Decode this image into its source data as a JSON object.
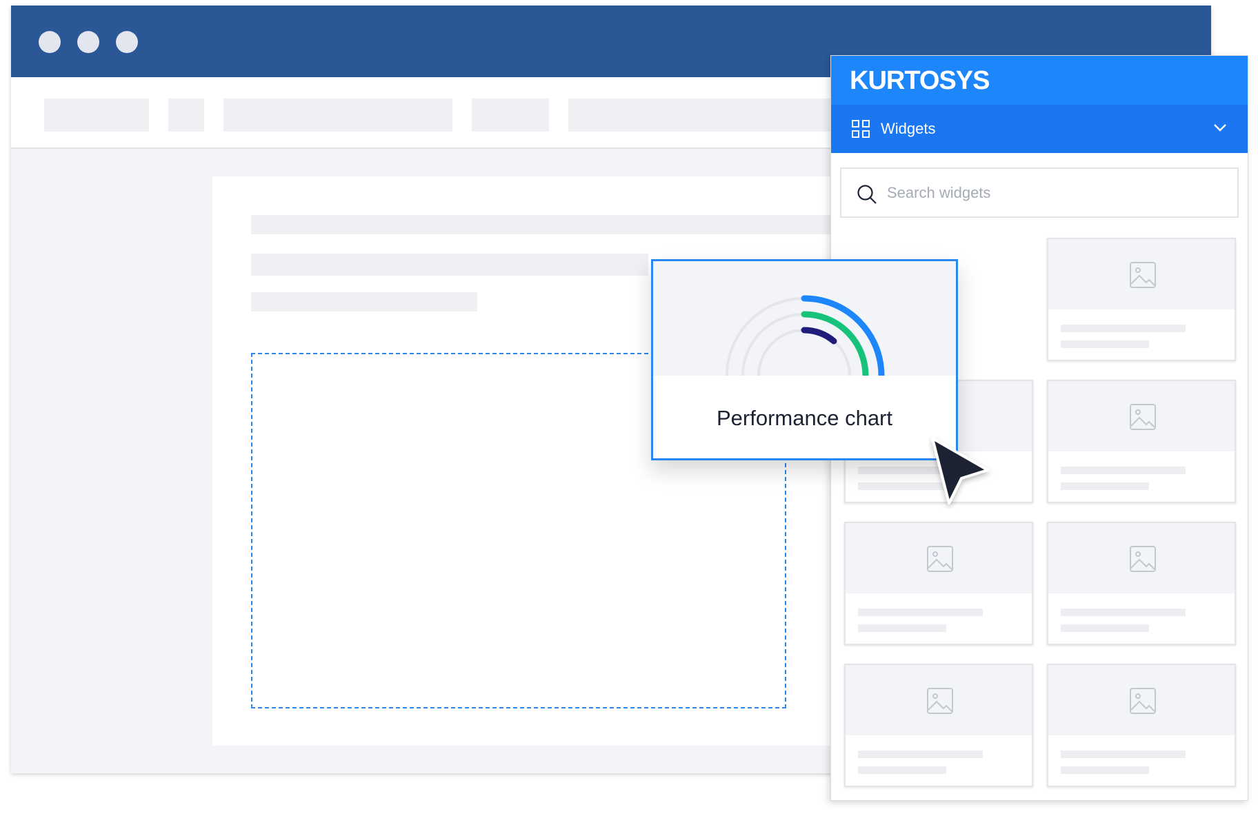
{
  "brand": {
    "logo_text": "KURTOSYS",
    "primary_color": "#1e86fb",
    "titlebar_color": "#2b5797"
  },
  "window": {
    "controls": [
      "window-dot",
      "window-dot",
      "window-dot"
    ]
  },
  "panel": {
    "section_label": "Widgets",
    "section_icon": "grid-icon",
    "dropdown_icon": "chevron-down-icon",
    "search": {
      "placeholder": "Search widgets",
      "icon": "search-icon"
    },
    "widgets_count": 7,
    "widget_icon": "image-placeholder-icon"
  },
  "dragged_widget": {
    "label": "Performance chart",
    "icon": "radial-chart-icon",
    "ring_colors": [
      "#1e86fb",
      "#17c27b",
      "#1f1c7a"
    ]
  },
  "cursor": {
    "icon": "pointer-cursor-icon"
  }
}
